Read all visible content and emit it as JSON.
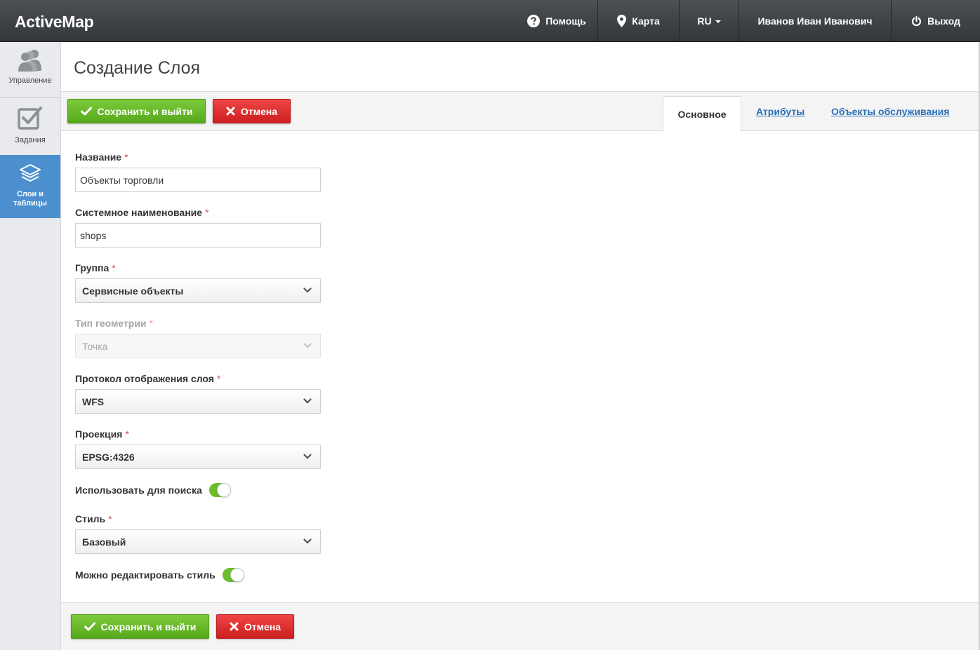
{
  "app": {
    "brand": "ActiveMap"
  },
  "topnav": {
    "help": "Помощь",
    "map": "Карта",
    "lang": "RU",
    "user": "Иванов Иван Иванович",
    "exit": "Выход"
  },
  "sidebar": {
    "items": [
      {
        "label": "Управление",
        "icon": "users-icon"
      },
      {
        "label": "Задания",
        "icon": "checkbox-icon"
      },
      {
        "label": "Слои и таблицы",
        "icon": "layers-icon",
        "active": true
      }
    ]
  },
  "page": {
    "title": "Создание Слоя"
  },
  "toolbar": {
    "save_label": "Сохранить и выйти",
    "cancel_label": "Отмена"
  },
  "tabs": {
    "main": "Основное",
    "attributes": "Атрибуты",
    "maintenance": "Объекты обслуживания"
  },
  "form": {
    "name": {
      "label": "Название",
      "value": "Объекты торговли"
    },
    "system_name": {
      "label": "Системное наименование",
      "value": "shops"
    },
    "group": {
      "label": "Группа",
      "value": "Сервисные объекты"
    },
    "geometry": {
      "label": "Тип геометрии",
      "value": "Точка",
      "disabled": true
    },
    "protocol": {
      "label": "Протокол отображения слоя",
      "value": "WFS"
    },
    "projection": {
      "label": "Проекция",
      "value": "EPSG:4326"
    },
    "use_search": {
      "label": "Использовать для поиска",
      "on": true
    },
    "style": {
      "label": "Стиль",
      "value": "Базовый"
    },
    "editable_style": {
      "label": "Можно редактировать стиль",
      "on": true
    },
    "required_mark": "*"
  },
  "footer": {
    "save_label": "Сохранить и выйти",
    "cancel_label": "Отмена"
  },
  "colors": {
    "topbar": "#3d4044",
    "accent_blue": "#4b8fcf",
    "green": "#6bbd2b",
    "red": "#dd3333"
  }
}
